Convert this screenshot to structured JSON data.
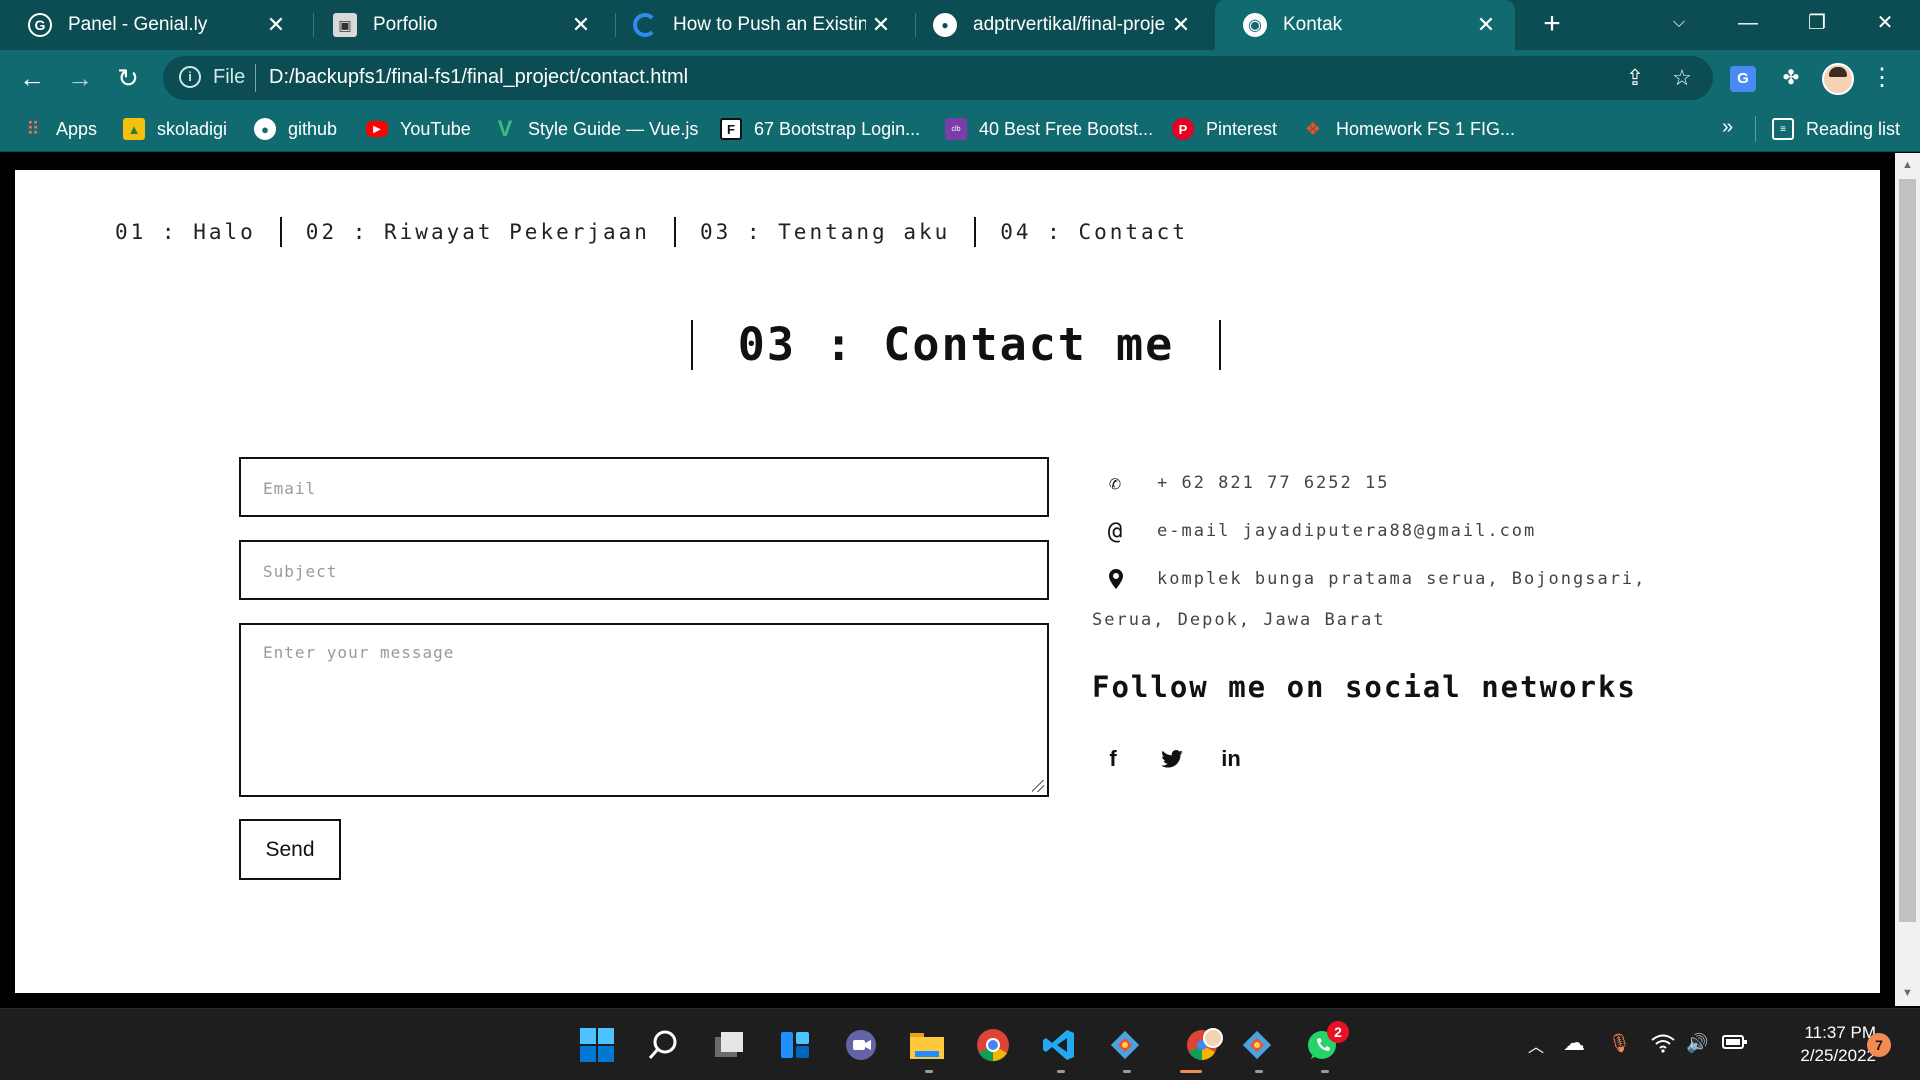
{
  "browser": {
    "tabs": [
      {
        "title": "Panel - Genial.ly",
        "icon": "genially-icon",
        "active": false
      },
      {
        "title": "Porfolio",
        "icon": "page-icon",
        "active": false
      },
      {
        "title": "How to Push an Existing P",
        "icon": "digitalocean-icon",
        "active": false
      },
      {
        "title": "adptrvertikal/final-project",
        "icon": "github-icon",
        "active": false
      },
      {
        "title": "Kontak",
        "icon": "globe-icon",
        "active": true
      }
    ],
    "address": {
      "scheme_label": "File",
      "url": "D:/backupfs1/final-fs1/final_project/contact.html"
    },
    "bookmarks": [
      {
        "label": "Apps",
        "icon": "apps-grid-icon"
      },
      {
        "label": "skoladigi",
        "icon": "image-icon"
      },
      {
        "label": "github",
        "icon": "github-icon"
      },
      {
        "label": "YouTube",
        "icon": "youtube-icon"
      },
      {
        "label": "Style Guide — Vue.js",
        "icon": "vue-icon"
      },
      {
        "label": "67 Bootstrap Login...",
        "icon": "bootstrap-f-icon"
      },
      {
        "label": "40 Best Free Bootst...",
        "icon": "colorlib-icon"
      },
      {
        "label": "Pinterest",
        "icon": "pinterest-icon"
      },
      {
        "label": "Homework FS 1 FIG...",
        "icon": "figma-icon"
      }
    ],
    "bookmarks_more": "»",
    "reading_list": "Reading list",
    "extension_badge": "G"
  },
  "page": {
    "nav": [
      "01 : Halo",
      "02 : Riwayat Pekerjaan",
      "03 : Tentang aku",
      "04 : Contact"
    ],
    "heading": "03 : Contact me",
    "form": {
      "email_placeholder": "Email",
      "subject_placeholder": "Subject",
      "message_placeholder": "Enter your message",
      "send_label": "Send"
    },
    "contact": {
      "phone": "+ 62 821 77 6252 15",
      "email": "e-mail jayadiputera88@gmail.com",
      "address_line1": "komplek bunga pratama serua, Bojongsari,",
      "address_line2": "Serua, Depok, Jawa Barat"
    },
    "follow_heading": "Follow me on social networks",
    "social": [
      "facebook-icon",
      "twitter-icon",
      "linkedin-icon"
    ]
  },
  "taskbar": {
    "apps": [
      "start-icon",
      "search-icon",
      "task-view-icon",
      "widgets-icon",
      "teams-chat-icon",
      "file-explorer-icon",
      "chrome-icon",
      "vscode-icon",
      "git-icon",
      "chrome-profile-icon",
      "git-icon-2",
      "whatsapp-icon"
    ],
    "whatsapp_badge": "2",
    "time": "11:37 PM",
    "date": "2/25/2022",
    "notifications": "7"
  },
  "colors": {
    "tab_strip": "#0b4d52",
    "toolbar": "#116a70",
    "page_background": "#ffffff",
    "text_dark": "#111111",
    "taskbar": "#1e1e1e"
  }
}
